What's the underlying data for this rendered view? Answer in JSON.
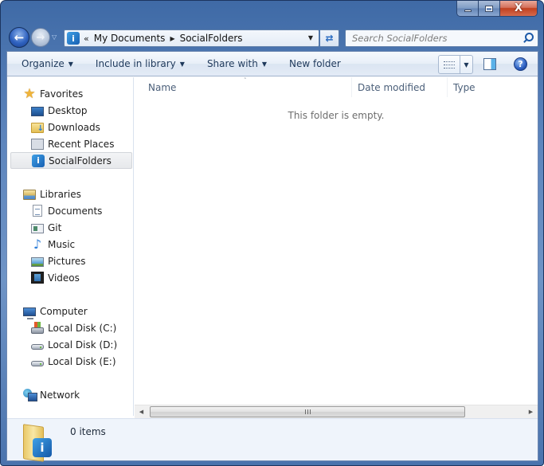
{
  "window": {
    "caption_buttons": {
      "minimize_icon": "minimize-icon",
      "maximize_icon": "maximize-icon",
      "close_glyph": "X"
    }
  },
  "navigation": {
    "back_glyph": "←",
    "forward_glyph": "→",
    "history_glyph": "▽",
    "address": {
      "overflow_glyph": "«",
      "segments": [
        "My Documents",
        "SocialFolders"
      ],
      "separator_glyph": "▶",
      "dropdown_glyph": "▼",
      "icon_glyph": "i"
    },
    "refresh_glyph": "⇄",
    "search": {
      "placeholder": "Search SocialFolders",
      "value": ""
    }
  },
  "toolbar": {
    "organize": "Organize",
    "include_in_library": "Include in library",
    "share_with": "Share with",
    "new_folder": "New folder",
    "caret": "▼",
    "help_glyph": "?"
  },
  "nav_pane": {
    "favorites": {
      "label": "Favorites",
      "items": [
        "Desktop",
        "Downloads",
        "Recent Places",
        "SocialFolders"
      ]
    },
    "libraries": {
      "label": "Libraries",
      "items": [
        "Documents",
        "Git",
        "Music",
        "Pictures",
        "Videos"
      ]
    },
    "computer": {
      "label": "Computer",
      "items": [
        "Local Disk (C:)",
        "Local Disk (D:)",
        "Local Disk (E:)"
      ]
    },
    "network": {
      "label": "Network"
    },
    "selected": "SocialFolders",
    "star_glyph": "★",
    "music_glyph": "♪",
    "sf_glyph": "i"
  },
  "content": {
    "columns": [
      "Name",
      "Date modified",
      "Type"
    ],
    "sort_glyph": "˄",
    "empty_message": "This folder is empty."
  },
  "scrollbar": {
    "left_glyph": "◀",
    "right_glyph": "▶"
  },
  "details": {
    "item_count": "0 items",
    "sf_glyph": "i"
  }
}
